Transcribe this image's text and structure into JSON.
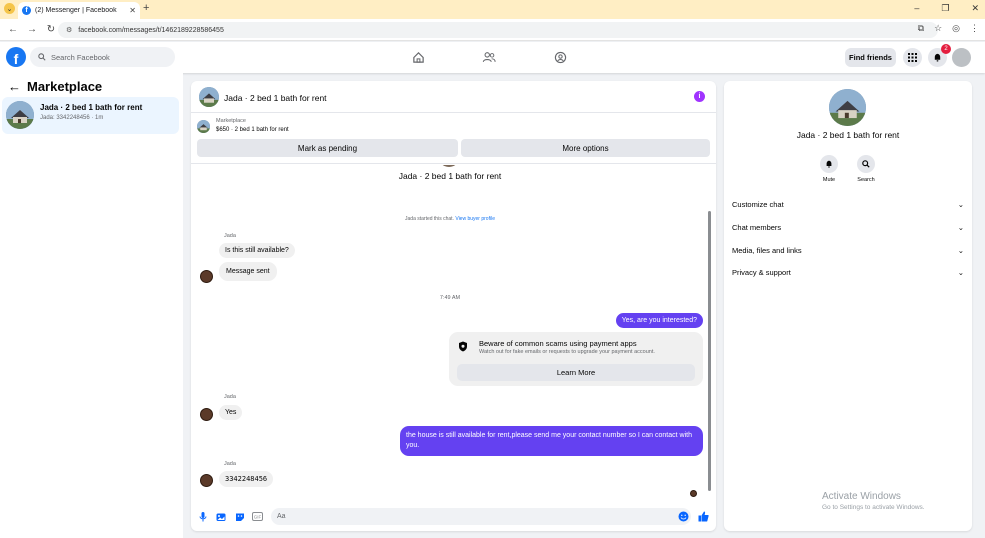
{
  "browser": {
    "tab_title": "(2) Messenger | Facebook",
    "url": "facebook.com/messages/t/1462189228586455"
  },
  "fb": {
    "search_placeholder": "Search Facebook",
    "find_friends": "Find friends",
    "notification_count": "2",
    "brand_color": "#1877f2"
  },
  "left": {
    "title": "Marketplace",
    "item": {
      "name": "Jada · 2 bed 1 bath for rent",
      "sub": "Jada: 3342248456 · 1m"
    }
  },
  "chat": {
    "header_title": "Jada · 2 bed 1 bath for rent",
    "marketplace_label": "Marketplace",
    "price_line": "$650 · 2 bed 1 bath for rent",
    "mark_pending": "Mark as pending",
    "more_options": "More options",
    "top_title": "Jada · 2 bed 1 bath for rent",
    "system_text": "Jada started this chat.",
    "system_link": "View buyer profile",
    "sender_name": "Jada",
    "msg1": "Is this still available?",
    "msg2": "Message sent",
    "time1": "7:49 AM",
    "out1": "Yes, are you interested?",
    "warn_title": "Beware of common scams using payment apps",
    "warn_sub": "Watch out for fake emails or requests to upgrade your payment account.",
    "learn_more": "Learn More",
    "msg3": "Yes",
    "out2": "the house is still available for rent,please send me your contact number so I can contact with you.",
    "msg4": "3342248456",
    "input_placeholder": "Aa",
    "outgoing_color": "#6441f1"
  },
  "right": {
    "name": "Jada · 2 bed 1 bath for rent",
    "mute": "Mute",
    "search": "Search",
    "rows": [
      "Customize chat",
      "Chat members",
      "Media, files and links",
      "Privacy & support"
    ]
  },
  "windows": {
    "activate": "Activate Windows",
    "activate_sub": "Go to Settings to activate Windows."
  }
}
